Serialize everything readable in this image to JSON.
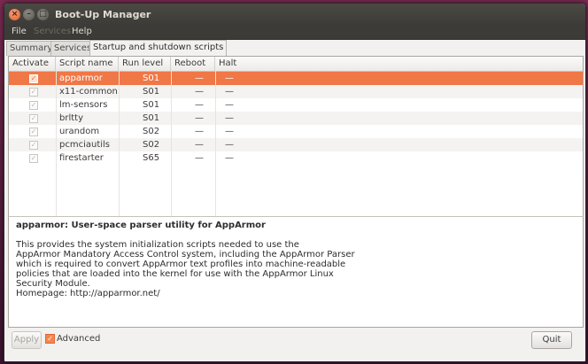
{
  "window": {
    "title": "Boot-Up Manager"
  },
  "titlebar_buttons": {
    "close": "×",
    "minimize": "–",
    "maximize": "□"
  },
  "menu": {
    "file": "File",
    "services": "Services",
    "help": "Help"
  },
  "tabs": [
    {
      "label": "Summary"
    },
    {
      "label": "Services"
    },
    {
      "label": "Startup and shutdown scripts"
    }
  ],
  "table": {
    "headers": [
      "Activate",
      "Script name",
      "Run level S",
      "Reboot",
      "Halt"
    ],
    "rows": [
      {
        "checked": true,
        "name": "apparmor",
        "runlevel": "S01",
        "reboot": "—",
        "halt": "—",
        "selected": true
      },
      {
        "checked": true,
        "name": "x11-common",
        "runlevel": "S01",
        "reboot": "—",
        "halt": "—"
      },
      {
        "checked": true,
        "name": "lm-sensors",
        "runlevel": "S01",
        "reboot": "—",
        "halt": "—"
      },
      {
        "checked": true,
        "name": "brltty",
        "runlevel": "S01",
        "reboot": "—",
        "halt": "—"
      },
      {
        "checked": true,
        "name": "urandom",
        "runlevel": "S02",
        "reboot": "—",
        "halt": "—"
      },
      {
        "checked": true,
        "name": "pcmciautils",
        "runlevel": "S02",
        "reboot": "—",
        "halt": "—"
      },
      {
        "checked": true,
        "name": "firestarter",
        "runlevel": "S65",
        "reboot": "—",
        "halt": "—"
      }
    ]
  },
  "description": {
    "heading": "apparmor:  User-space parser utility for AppArmor",
    "lines": [
      "This provides the system initialization scripts needed to use the",
      "AppArmor Mandatory Access Control system, including the AppArmor Parser",
      "which is required to convert AppArmor text profiles into machine-readable",
      "policies that are loaded into the kernel for use with the AppArmor Linux",
      "Security Module.",
      "Homepage: http://apparmor.net/"
    ]
  },
  "footer": {
    "apply": "Apply",
    "advanced": "Advanced",
    "advanced_checked": true,
    "quit": "Quit"
  },
  "colors": {
    "selection": "#f07746",
    "titlebar": "#3c3b37",
    "accent": "#e05a24"
  }
}
